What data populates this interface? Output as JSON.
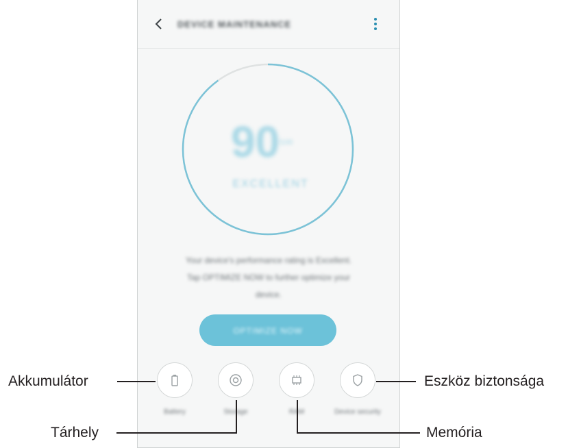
{
  "app": {
    "title": "DEVICE MAINTENANCE",
    "back_icon": "chevron-left-icon",
    "menu_icon": "more-vertical-icon"
  },
  "gauge": {
    "score": "90",
    "max_label": "/100",
    "rating": "EXCELLENT",
    "progress_fraction": 0.9,
    "arc_color": "#7cc3d7",
    "track_color": "#dfe2e2"
  },
  "message": {
    "line1": "Your device's performance rating is Excellent.",
    "line2": "Tap OPTIMIZE NOW to further optimize your",
    "line3": "device."
  },
  "optimize_button": {
    "label": "OPTIMIZE NOW",
    "color": "#6cc2d9"
  },
  "features": [
    {
      "id": "battery",
      "icon": "battery-icon",
      "label": "Battery",
      "sub": ""
    },
    {
      "id": "storage",
      "icon": "storage-icon",
      "label": "Storage",
      "sub": ""
    },
    {
      "id": "memory",
      "icon": "memory-chip-icon",
      "label": "RAM",
      "sub": ""
    },
    {
      "id": "security",
      "icon": "shield-icon",
      "label": "Device security",
      "sub": ""
    }
  ],
  "callouts": {
    "battery": "Akkumulátor",
    "storage": "Tárhely",
    "memory": "Memória",
    "security": "Eszköz biztonsága"
  }
}
